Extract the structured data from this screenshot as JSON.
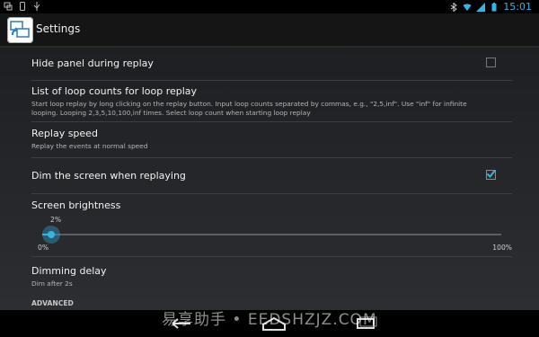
{
  "status_bar": {
    "time": "15:01"
  },
  "action_bar": {
    "title": "Settings"
  },
  "prefs": {
    "hide_panel": {
      "title": "Hide panel during replay",
      "checked": false
    },
    "loop_counts": {
      "title": "List of loop counts for loop replay",
      "summary_line1": "Start loop replay by long clicking on the replay button. Input loop counts separated by commas, e.g., \"2,5,inf\". Use \"inf\" for infinite",
      "summary_line2": "looping. Looping 2,3,5,10,100,inf times. Select loop count when starting loop replay"
    },
    "replay_speed": {
      "title": "Replay speed",
      "summary": "Replay the events at normal speed"
    },
    "dim_screen": {
      "title": "Dim the screen when replaying",
      "checked": true
    },
    "brightness": {
      "title": "Screen brightness",
      "value_label": "2%",
      "value_percent": 2,
      "min_label": "0%",
      "max_label": "100%"
    },
    "dimming_delay": {
      "title": "Dimming delay",
      "summary": "Dim after 2s"
    }
  },
  "section": {
    "advanced": "ADVANCED"
  },
  "watermark": "易享助手 • EEDSHZJZ.COM",
  "colors": {
    "accent": "#33b5e5"
  }
}
